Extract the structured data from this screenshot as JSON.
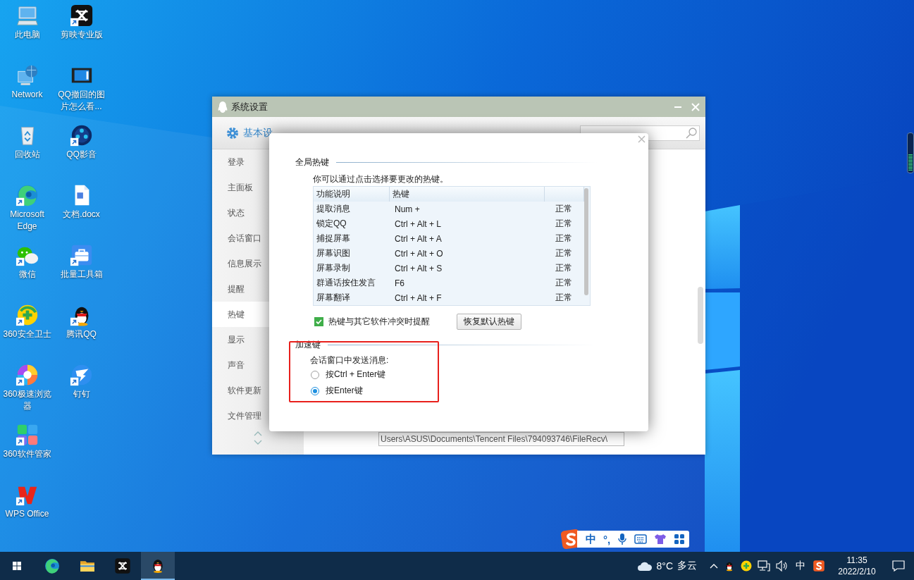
{
  "desktop_icons": [
    {
      "label": "此电脑",
      "kind": "computer",
      "shortcut": false
    },
    {
      "label": "Network",
      "kind": "network",
      "shortcut": false
    },
    {
      "label": "回收站",
      "kind": "recycle",
      "shortcut": false
    },
    {
      "label": "Microsoft Edge",
      "kind": "edge",
      "shortcut": true
    },
    {
      "label": "微信",
      "kind": "wechat",
      "shortcut": true
    },
    {
      "label": "360安全卫士",
      "kind": "security",
      "shortcut": true
    },
    {
      "label": "360极速浏览器",
      "kind": "browser360",
      "shortcut": true
    },
    {
      "label": "360软件管家",
      "kind": "manager360",
      "shortcut": true
    },
    {
      "label": "WPS Office",
      "kind": "wps",
      "shortcut": true
    },
    {
      "label": "剪映专业版",
      "kind": "capcut",
      "shortcut": true
    },
    {
      "label": "QQ撤回的图片怎么看...",
      "kind": "video",
      "shortcut": false
    },
    {
      "label": "QQ影音",
      "kind": "player",
      "shortcut": true
    },
    {
      "label": "文档.docx",
      "kind": "document",
      "shortcut": false
    },
    {
      "label": "批量工具箱",
      "kind": "toolbox",
      "shortcut": true
    },
    {
      "label": "腾讯QQ",
      "kind": "penguin",
      "shortcut": true
    },
    {
      "label": "钉钉",
      "kind": "dingtalk",
      "shortcut": true
    }
  ],
  "settings_window": {
    "title": "系统设置",
    "tabs": [
      {
        "label": "基本设",
        "selected": true
      }
    ],
    "sidebar": {
      "items": [
        {
          "label": "登录",
          "selected": false
        },
        {
          "label": "主面板",
          "selected": false
        },
        {
          "label": "状态",
          "selected": false
        },
        {
          "label": "会话窗口",
          "selected": false
        },
        {
          "label": "信息展示",
          "selected": false
        },
        {
          "label": "提醒",
          "selected": false
        },
        {
          "label": "热键",
          "selected": true
        },
        {
          "label": "显示",
          "selected": false
        },
        {
          "label": "声音",
          "selected": false
        },
        {
          "label": "软件更新",
          "selected": false
        },
        {
          "label": "文件管理",
          "selected": false
        }
      ]
    },
    "path_field": {
      "value": "Users\\ASUS\\Documents\\Tencent Files\\794093746\\FileRecv\\"
    }
  },
  "hotkey_dialog": {
    "global_hotkeys": {
      "heading": "全局热键",
      "hint": "你可以通过点击选择要更改的热键。",
      "table": {
        "columns": [
          "功能说明",
          "热键"
        ],
        "rows": [
          {
            "cells": [
              "提取消息",
              "Num +",
              "正常"
            ]
          },
          {
            "cells": [
              "锁定QQ",
              "Ctrl + Alt + L",
              "正常"
            ]
          },
          {
            "cells": [
              "捕捉屏幕",
              "Ctrl + Alt + A",
              "正常"
            ]
          },
          {
            "cells": [
              "屏幕识图",
              "Ctrl + Alt + O",
              "正常"
            ]
          },
          {
            "cells": [
              "屏幕录制",
              "Ctrl + Alt + S",
              "正常"
            ]
          },
          {
            "cells": [
              "群通话按住发言",
              "F6",
              "正常"
            ]
          },
          {
            "cells": [
              "屏幕翻译",
              "Ctrl + Alt + F",
              "正常"
            ]
          }
        ]
      },
      "conflict_alert": {
        "label": "热键与其它软件冲突时提醒",
        "checked": true
      },
      "restore_button": "恢复默认热键"
    },
    "accelerators": {
      "heading": "加速键",
      "prompt": "会话窗口中发送消息:",
      "options": [
        {
          "label": "按Ctrl + Enter键",
          "selected": false
        },
        {
          "label": "按Enter键",
          "selected": true
        }
      ]
    }
  },
  "ime_toolbar": {
    "mode": "中",
    "punctuation": "°,"
  },
  "taskbar": {
    "apps": [
      {
        "kind": "start",
        "selected": false
      },
      {
        "kind": "edge",
        "selected": false
      },
      {
        "kind": "folder",
        "selected": false
      },
      {
        "kind": "capcut",
        "selected": false
      },
      {
        "kind": "penguin",
        "selected": true
      }
    ],
    "weather": {
      "temperature": "8°C",
      "condition": "多云"
    },
    "input_mode": "中",
    "clock": {
      "time": "11:35",
      "date": "2022/2/10"
    }
  }
}
